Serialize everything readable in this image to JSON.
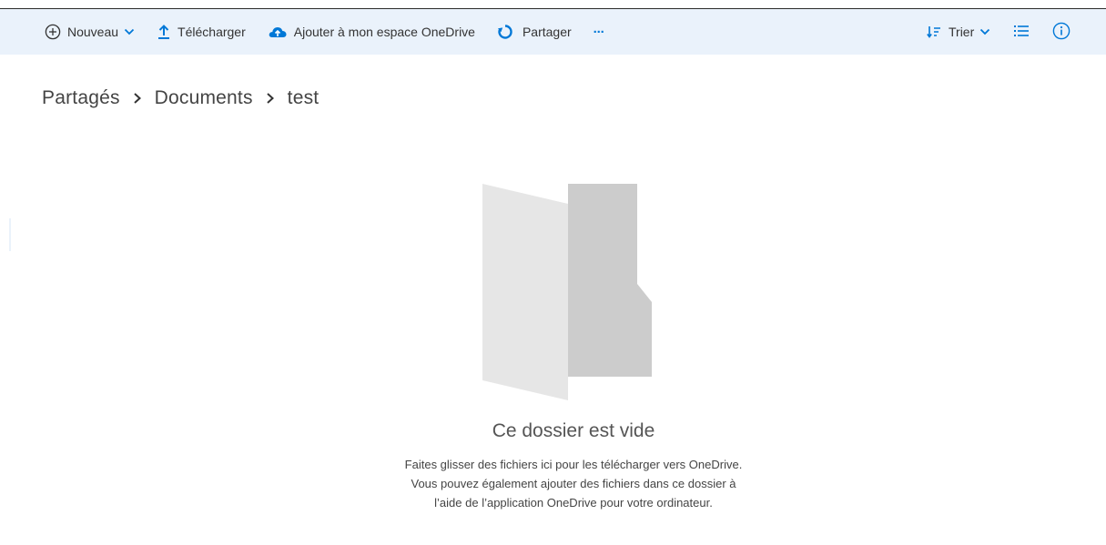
{
  "toolbar": {
    "new_label": "Nouveau",
    "upload_label": "Télécharger",
    "add_to_onedrive_label": "Ajouter à mon espace OneDrive",
    "share_label": "Partager",
    "more_label": "···",
    "sort_label": "Trier"
  },
  "breadcrumb": {
    "items": [
      "Partagés",
      "Documents",
      "test"
    ]
  },
  "empty_state": {
    "title": "Ce dossier est vide",
    "lines": [
      "Faites glisser des fichiers ici pour les télécharger vers OneDrive.",
      "Vous pouvez également ajouter des fichiers dans ce dossier à",
      "l’aide de l’application OneDrive pour votre ordinateur."
    ]
  },
  "icons": {
    "new": "plus-circle-icon",
    "upload": "upload-arrow-icon",
    "add_to_onedrive": "cloud-add-icon",
    "share": "share-icon",
    "more": "ellipsis-icon",
    "sort": "sort-icon",
    "view": "list-view-icon",
    "info": "info-icon"
  },
  "colors": {
    "accent": "#0078d7",
    "command_bar_bg": "#eaf2fb",
    "folder_front": "#e6e6e6",
    "folder_back": "#cccccc"
  }
}
